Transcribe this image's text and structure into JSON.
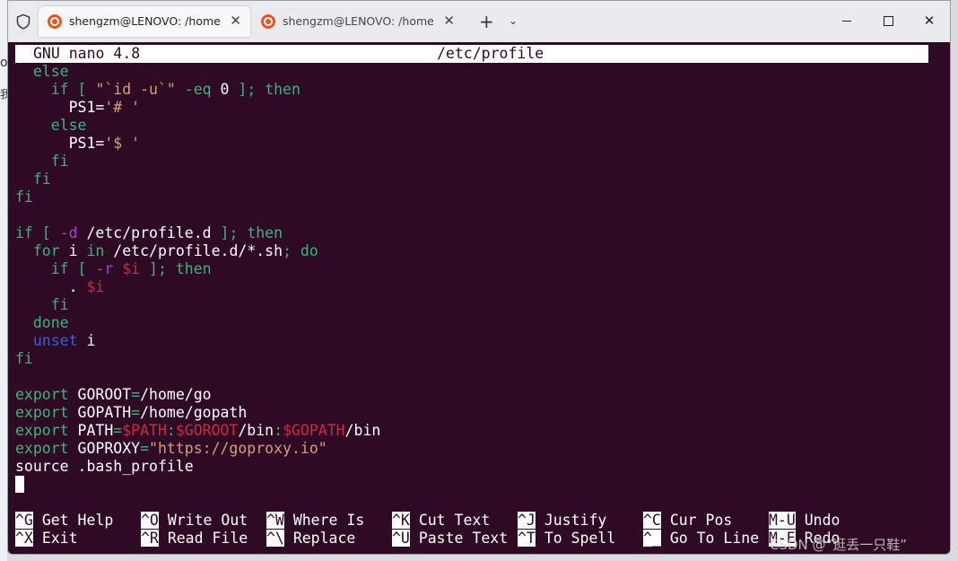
{
  "tabs": [
    {
      "title": "shengzm@LENOVO: /home/go",
      "active": true
    },
    {
      "title": "shengzm@LENOVO: /home/w",
      "active": false
    }
  ],
  "tab_close_glyph": "✕",
  "new_tab_glyph": "+",
  "tab_dropdown_glyph": "⌄",
  "window_close_glyph": "✕",
  "desktop_glyphs": [
    "o",
    "我"
  ],
  "nano": {
    "version": "GNU nano 4.8",
    "filename": "/etc/profile"
  },
  "editor_lines": [
    [
      {
        "t": "  "
      },
      {
        "t": "else",
        "c": "kw"
      }
    ],
    [
      {
        "t": "    "
      },
      {
        "t": "if",
        "c": "kw"
      },
      {
        "t": " [ ",
        "c": "kw"
      },
      {
        "t": "\"`id -u`\"",
        "c": "str"
      },
      {
        "t": " -eq ",
        "c": "kw"
      },
      {
        "t": "0"
      },
      {
        "t": " ]; then",
        "c": "kw"
      }
    ],
    [
      {
        "t": "      PS1="
      },
      {
        "t": "'# '",
        "c": "str"
      }
    ],
    [
      {
        "t": "    "
      },
      {
        "t": "else",
        "c": "kw"
      }
    ],
    [
      {
        "t": "      PS1="
      },
      {
        "t": "'$ '",
        "c": "str"
      }
    ],
    [
      {
        "t": "    "
      },
      {
        "t": "fi",
        "c": "kw"
      }
    ],
    [
      {
        "t": "  "
      },
      {
        "t": "fi",
        "c": "kw"
      }
    ],
    [
      {
        "t": "fi",
        "c": "kw"
      }
    ],
    [
      {
        "t": ""
      }
    ],
    [
      {
        "t": "if",
        "c": "kw"
      },
      {
        "t": " [ ",
        "c": "kw"
      },
      {
        "t": "-d",
        "c": "op"
      },
      {
        "t": " /etc/profile.d "
      },
      {
        "t": "]; then",
        "c": "kw"
      }
    ],
    [
      {
        "t": "  "
      },
      {
        "t": "for",
        "c": "kw"
      },
      {
        "t": " i "
      },
      {
        "t": "in",
        "c": "kw"
      },
      {
        "t": " /etc/profile.d/*.sh"
      },
      {
        "t": "; do",
        "c": "kw"
      }
    ],
    [
      {
        "t": "    "
      },
      {
        "t": "if",
        "c": "kw"
      },
      {
        "t": " [ ",
        "c": "kw"
      },
      {
        "t": "-r",
        "c": "op"
      },
      {
        "t": " "
      },
      {
        "t": "$i",
        "c": "var"
      },
      {
        "t": " ]; then",
        "c": "kw"
      }
    ],
    [
      {
        "t": "      . "
      },
      {
        "t": "$i",
        "c": "var"
      }
    ],
    [
      {
        "t": "    "
      },
      {
        "t": "fi",
        "c": "kw"
      }
    ],
    [
      {
        "t": "  "
      },
      {
        "t": "done",
        "c": "kw"
      }
    ],
    [
      {
        "t": "  "
      },
      {
        "t": "unset",
        "c": "bl"
      },
      {
        "t": " i"
      }
    ],
    [
      {
        "t": "fi",
        "c": "kw"
      }
    ],
    [
      {
        "t": ""
      }
    ],
    [
      {
        "t": "export",
        "c": "kw"
      },
      {
        "t": " GOROOT"
      },
      {
        "t": "=",
        "c": "kw"
      },
      {
        "t": "/home/go"
      }
    ],
    [
      {
        "t": "export",
        "c": "kw"
      },
      {
        "t": " GOPATH"
      },
      {
        "t": "=",
        "c": "kw"
      },
      {
        "t": "/home/gopath"
      }
    ],
    [
      {
        "t": "export",
        "c": "kw"
      },
      {
        "t": " PATH"
      },
      {
        "t": "=",
        "c": "kw"
      },
      {
        "t": "$PATH",
        "c": "var"
      },
      {
        "t": ":",
        "c": "kw"
      },
      {
        "t": "$GOROOT",
        "c": "var"
      },
      {
        "t": "/bin"
      },
      {
        "t": ":",
        "c": "kw"
      },
      {
        "t": "$GOPATH",
        "c": "var"
      },
      {
        "t": "/bin"
      }
    ],
    [
      {
        "t": "export",
        "c": "kw"
      },
      {
        "t": " GOPROXY"
      },
      {
        "t": "=",
        "c": "kw"
      },
      {
        "t": "\"https://goproxy.io\"",
        "c": "str"
      }
    ],
    [
      {
        "t": "source .bash_profile"
      }
    ]
  ],
  "shortcuts": [
    [
      {
        "key": "^G",
        "label": "Get Help"
      },
      {
        "key": "^O",
        "label": "Write Out"
      },
      {
        "key": "^W",
        "label": "Where Is"
      },
      {
        "key": "^K",
        "label": "Cut Text"
      },
      {
        "key": "^J",
        "label": "Justify"
      },
      {
        "key": "^C",
        "label": "Cur Pos"
      },
      {
        "key": "M-U",
        "label": "Undo"
      }
    ],
    [
      {
        "key": "^X",
        "label": "Exit"
      },
      {
        "key": "^R",
        "label": "Read File"
      },
      {
        "key": "^\\",
        "label": "Replace"
      },
      {
        "key": "^U",
        "label": "Paste Text"
      },
      {
        "key": "^T",
        "label": "To Spell"
      },
      {
        "key": "^_",
        "label": "Go To Line"
      },
      {
        "key": "M-E",
        "label": "Redo"
      }
    ]
  ],
  "watermark": "CSDN @“逛丢一只鞋”",
  "colors": {
    "terminal_bg": "#2e0a24",
    "keyword": "#3fb37f",
    "variable": "#d0283c",
    "string": "#d5a078",
    "option": "#a246c9",
    "builtin": "#3563d1"
  }
}
